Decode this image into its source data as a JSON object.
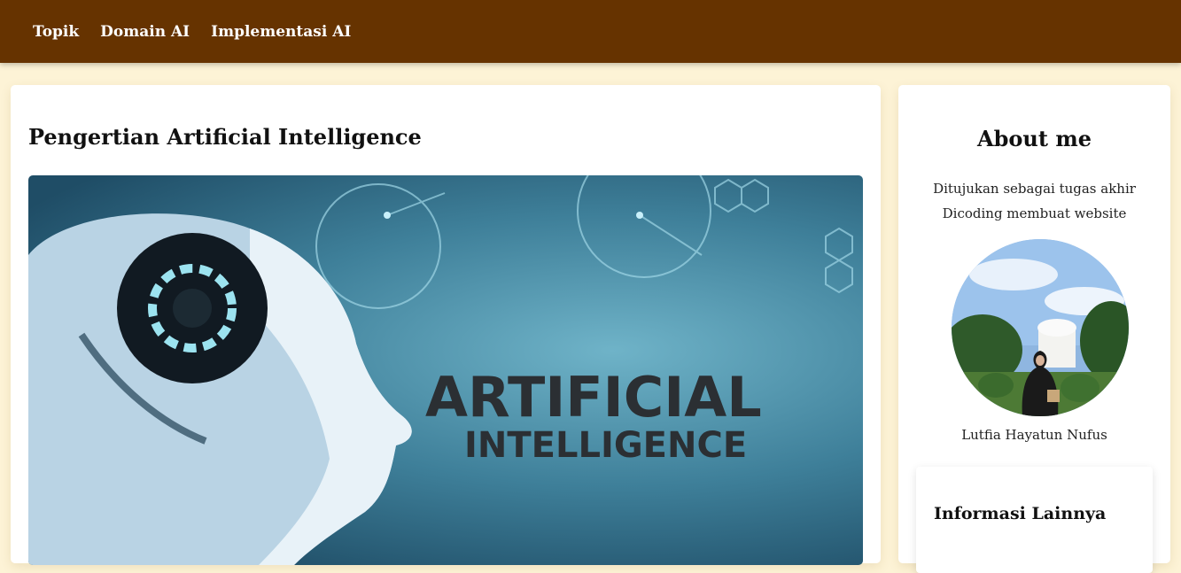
{
  "nav": {
    "items": [
      {
        "label": "Topik"
      },
      {
        "label": "Domain AI"
      },
      {
        "label": "Implementasi AI"
      }
    ]
  },
  "article": {
    "title": "Pengertian Artificial Intelligence",
    "image": {
      "text_line1": "ARTIFICIAL",
      "text_line2": "INTELLIGENCE"
    }
  },
  "sidebar": {
    "about_title": "About me",
    "about_text": "Ditujukan sebagai tugas akhir Dicoding membuat website",
    "profile_name": "Lutfia Hayatun Nufus",
    "info_title": "Informasi Lainnya"
  },
  "colors": {
    "nav_bg": "#663300",
    "page_bg": "#fdf3d6",
    "card_bg": "#ffffff"
  }
}
